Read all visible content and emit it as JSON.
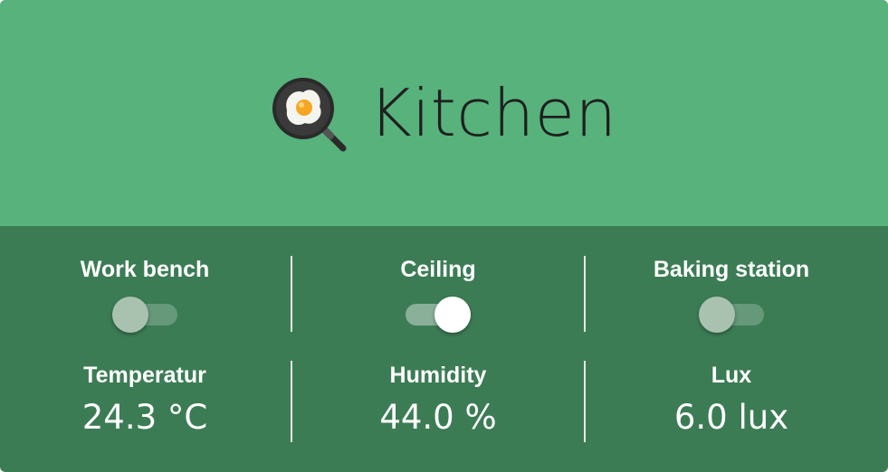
{
  "card": {
    "title": "Kitchen",
    "icon": "frying-pan-egg-icon",
    "colors": {
      "header": "#57b27b",
      "body": "#3c7c55",
      "text_title": "#1f1f1f",
      "text_body": "#ffffff"
    }
  },
  "switches": [
    {
      "label": "Work bench",
      "state": "off"
    },
    {
      "label": "Ceiling",
      "state": "on"
    },
    {
      "label": "Baking station",
      "state": "off"
    }
  ],
  "sensors": [
    {
      "label": "Temperatur",
      "value": "24.3 °C"
    },
    {
      "label": "Humidity",
      "value": "44.0 %"
    },
    {
      "label": "Lux",
      "value": "6.0 lux"
    }
  ]
}
